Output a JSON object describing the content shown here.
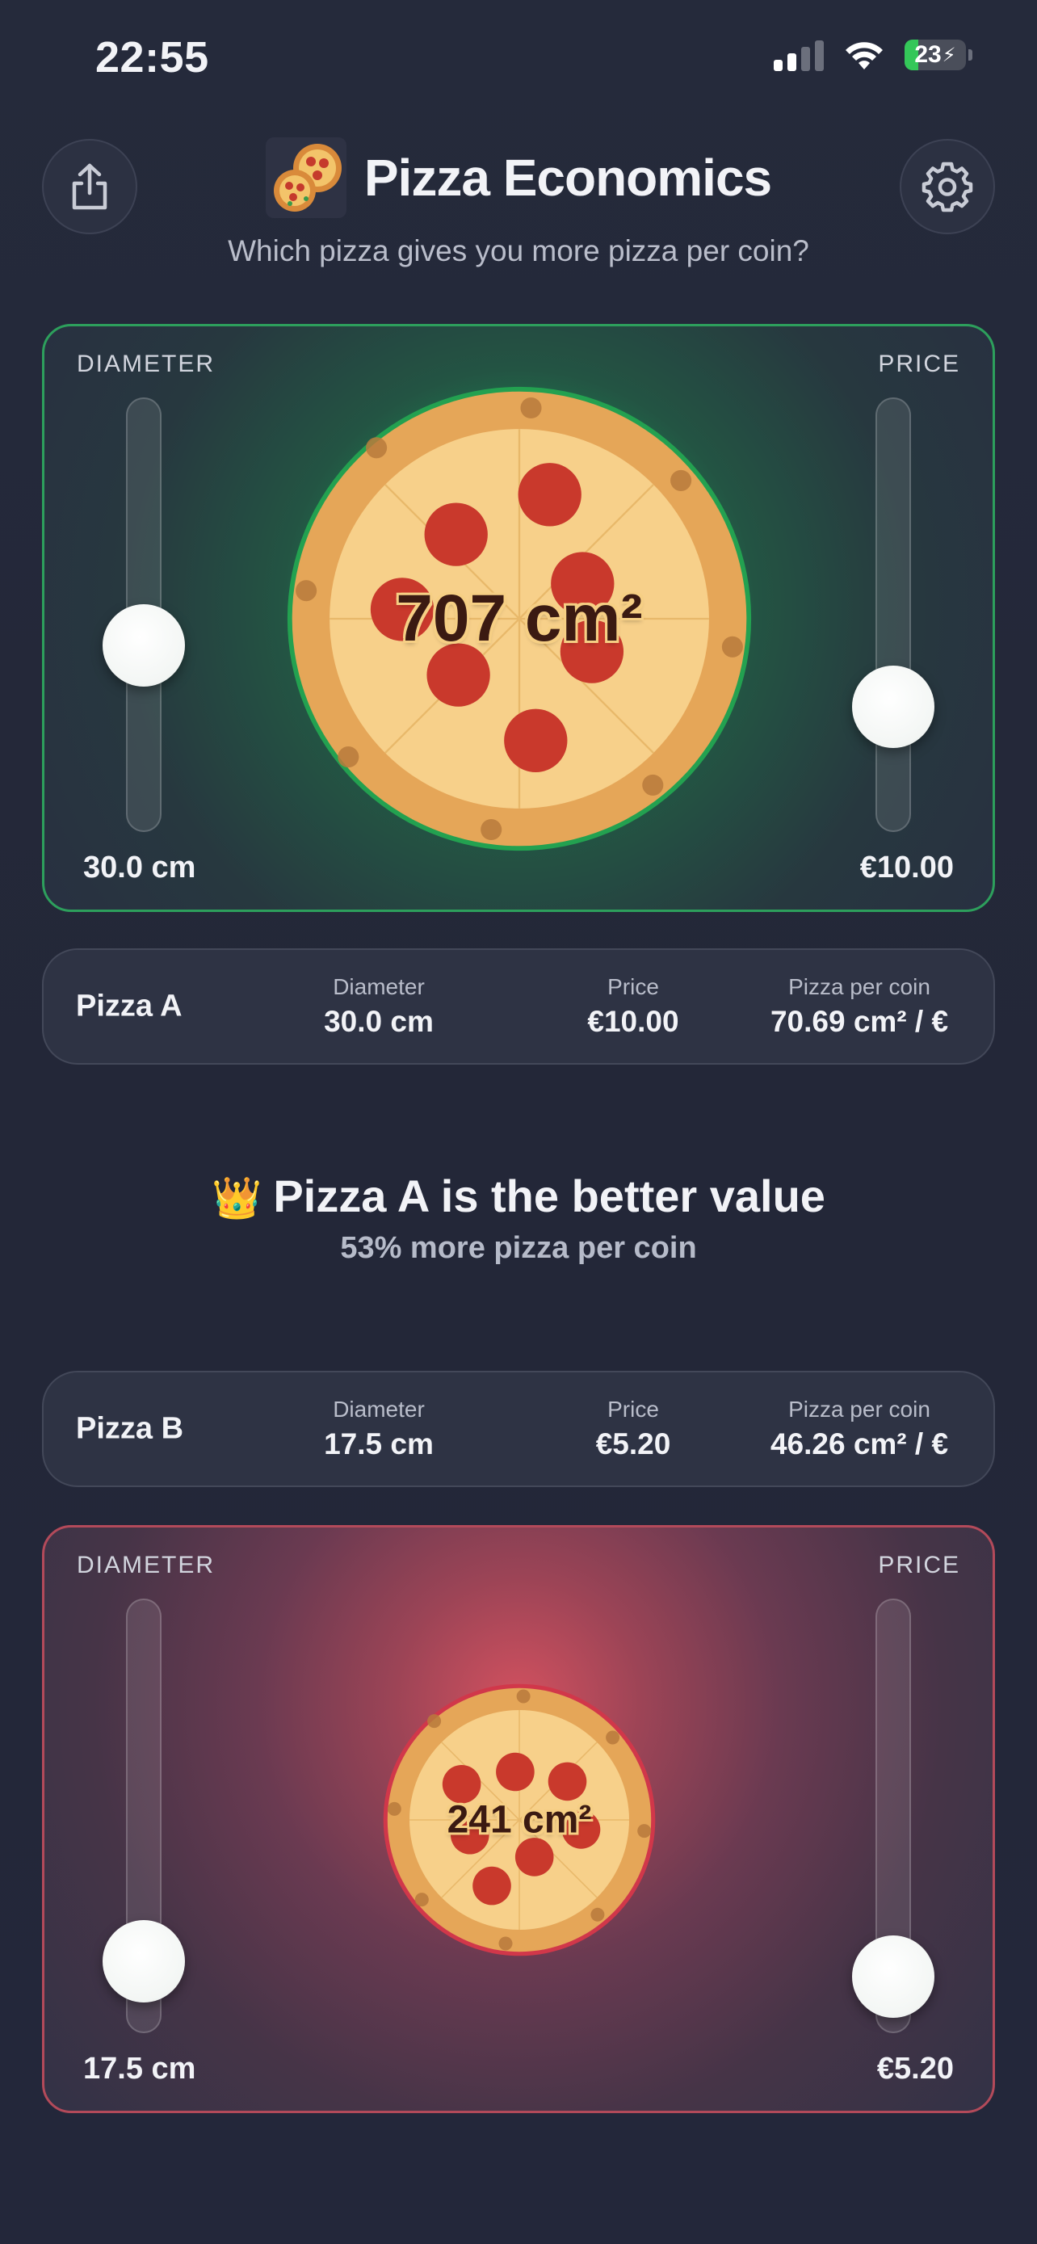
{
  "status_bar": {
    "time": "22:55",
    "battery_level": "23",
    "battery_fraction": 0.23,
    "signal_bars_on": 2,
    "signal_bars_total": 4
  },
  "header": {
    "title": "Pizza Economics",
    "subtitle": "Which pizza gives you more pizza per coin?",
    "share_icon": "share-icon",
    "settings_icon": "gear-icon"
  },
  "pizza_a": {
    "diameter_label": "DIAMETER",
    "price_label": "PRICE",
    "diameter_value": "30.0 cm",
    "price_value": "€10.00",
    "area": "707 cm²",
    "diameter_slider_fraction": 0.42,
    "price_slider_fraction": 0.26,
    "accent_color": "#2d9f5c"
  },
  "stats_a": {
    "name": "Pizza A",
    "diameter_label": "Diameter",
    "diameter": "30.0 cm",
    "price_label": "Price",
    "price": "€10.00",
    "ppc_label": "Pizza per coin",
    "ppc": "70.69 cm² / €"
  },
  "verdict": {
    "crown": "👑",
    "title": "Pizza A is the better value",
    "subtitle": "53% more pizza per coin"
  },
  "stats_b": {
    "name": "Pizza B",
    "diameter_label": "Diameter",
    "diameter": "17.5 cm",
    "price_label": "Price",
    "price": "€5.20",
    "ppc_label": "Pizza per coin",
    "ppc": "46.26 cm² / €"
  },
  "pizza_b": {
    "diameter_label": "DIAMETER",
    "price_label": "PRICE",
    "diameter_value": "17.5 cm",
    "price_value": "€5.20",
    "area": "241 cm²",
    "diameter_slider_fraction": 0.12,
    "price_slider_fraction": 0.08,
    "accent_color": "#b34a5a"
  }
}
